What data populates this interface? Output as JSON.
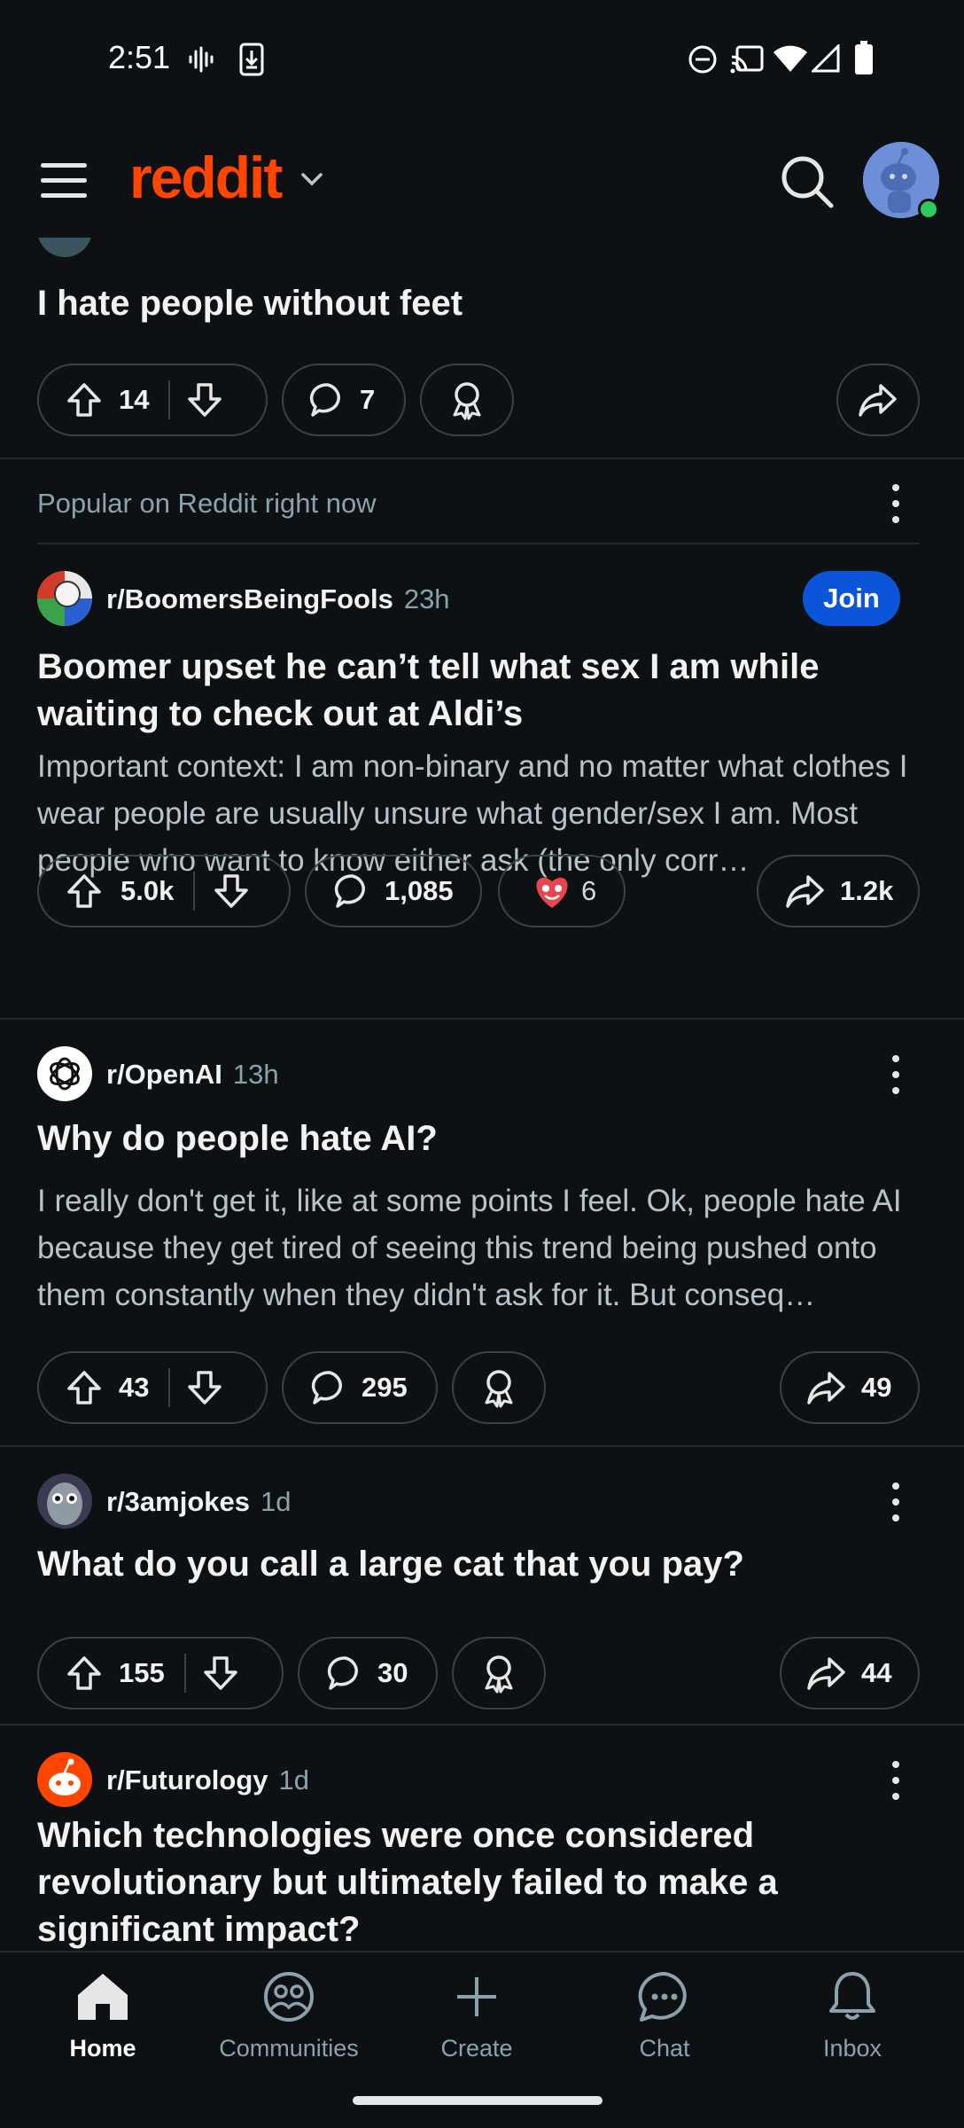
{
  "status": {
    "time": "2:51"
  },
  "header": {
    "logo": "reddit"
  },
  "partial_post": {
    "title": "I hate people without feet",
    "upvotes": "14",
    "comments": "7"
  },
  "popular": {
    "label": "Popular on Reddit right now"
  },
  "posts": [
    {
      "subreddit": "r/BoomersBeingFools",
      "time": "23h",
      "join_label": "Join",
      "title": "Boomer upset he can’t tell what sex I am while waiting to check out at Aldi’s",
      "body": "Important context: I am non-binary and no matter what clothes I wear people are usually unsure what gender/sex I am. Most people who want to know either ask (the only corr…",
      "upvotes": "5.0k",
      "comments": "1,085",
      "awards": "6",
      "shares": "1.2k"
    },
    {
      "subreddit": "r/OpenAI",
      "time": "13h",
      "title": "Why do people hate AI?",
      "body": "I really don't get it, like at some points I feel. Ok, people hate AI because they get tired of seeing this trend being pushed onto them constantly when they didn't ask for it. But conseq…",
      "upvotes": "43",
      "comments": "295",
      "shares": "49"
    },
    {
      "subreddit": "r/3amjokes",
      "time": "1d",
      "title": "What do you call a large cat that you pay?",
      "upvotes": "155",
      "comments": "30",
      "shares": "44"
    },
    {
      "subreddit": "r/Futurology",
      "time": "1d",
      "title": "Which technologies were once considered revolutionary but ultimately failed to make a significant impact?"
    }
  ],
  "nav": {
    "home": "Home",
    "communities": "Communities",
    "create": "Create",
    "chat": "Chat",
    "inbox": "Inbox"
  },
  "colors": {
    "background": "#0e1113",
    "brand": "#ff4500",
    "join": "#0a55d8",
    "muted": "#8ba2ad"
  }
}
